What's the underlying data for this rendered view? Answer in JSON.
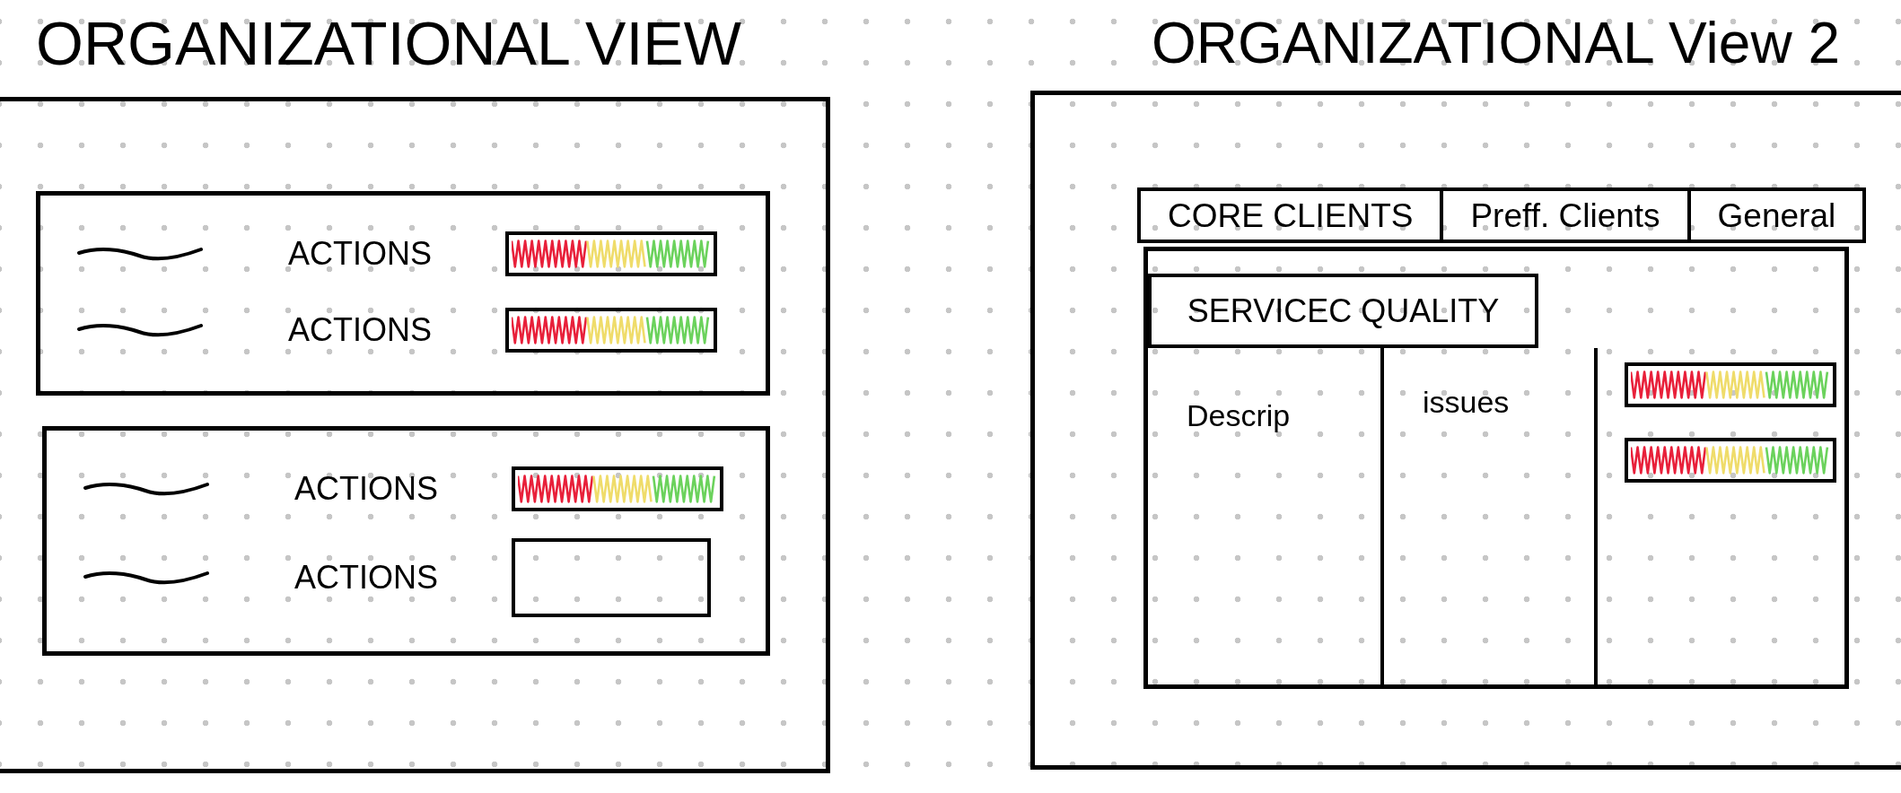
{
  "left_panel": {
    "title": "ORGANIZATIONAL VIEW",
    "cards": [
      {
        "rows": [
          {
            "label": "ACTIONS",
            "kind": "rating"
          },
          {
            "label": "ACTIONS",
            "kind": "rating"
          }
        ]
      },
      {
        "rows": [
          {
            "label": "ACTIONS",
            "kind": "rating"
          },
          {
            "label": "ACTIONS",
            "kind": "field"
          }
        ]
      }
    ]
  },
  "right_panel": {
    "title": "ORGANIZATIONAL View 2",
    "tabs": [
      {
        "label": "CORE CLIENTS"
      },
      {
        "label": "Preff. Clients"
      },
      {
        "label": "General"
      }
    ],
    "section": {
      "tab": "SERVICEC QUALITY",
      "columns": [
        {
          "heading": "Descrip"
        },
        {
          "heading": "issues"
        }
      ],
      "widgets": [
        {
          "kind": "rating"
        },
        {
          "kind": "rating"
        }
      ]
    }
  }
}
